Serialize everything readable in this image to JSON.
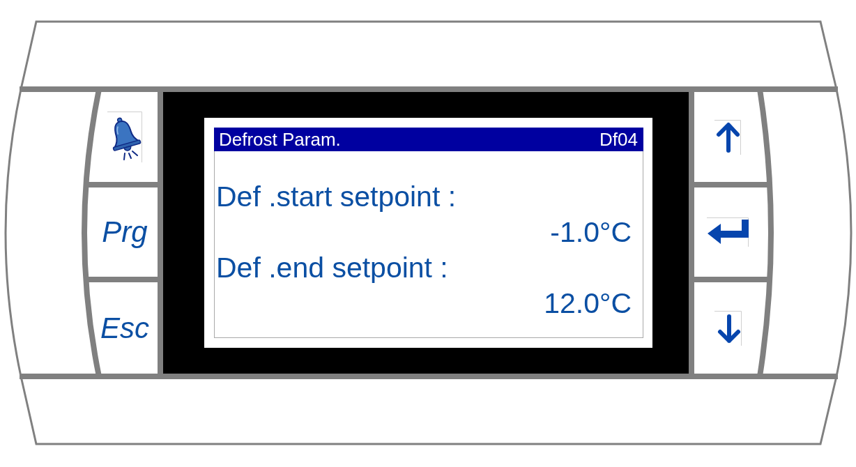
{
  "left_keys": [
    {
      "kind": "alarm"
    },
    {
      "kind": "prg",
      "label": "Prg"
    },
    {
      "kind": "esc",
      "label": "Esc"
    }
  ],
  "display": {
    "header": {
      "title": "Defrost Param.",
      "code": "Df04"
    },
    "parameters": [
      {
        "label": "Def .start setpoint :",
        "value": "-1.0°C"
      },
      {
        "label": "Def .end setpoint :",
        "value": "12.0°C"
      }
    ]
  },
  "right_keys": [
    {
      "kind": "up"
    },
    {
      "kind": "enter"
    },
    {
      "kind": "down"
    }
  ]
}
